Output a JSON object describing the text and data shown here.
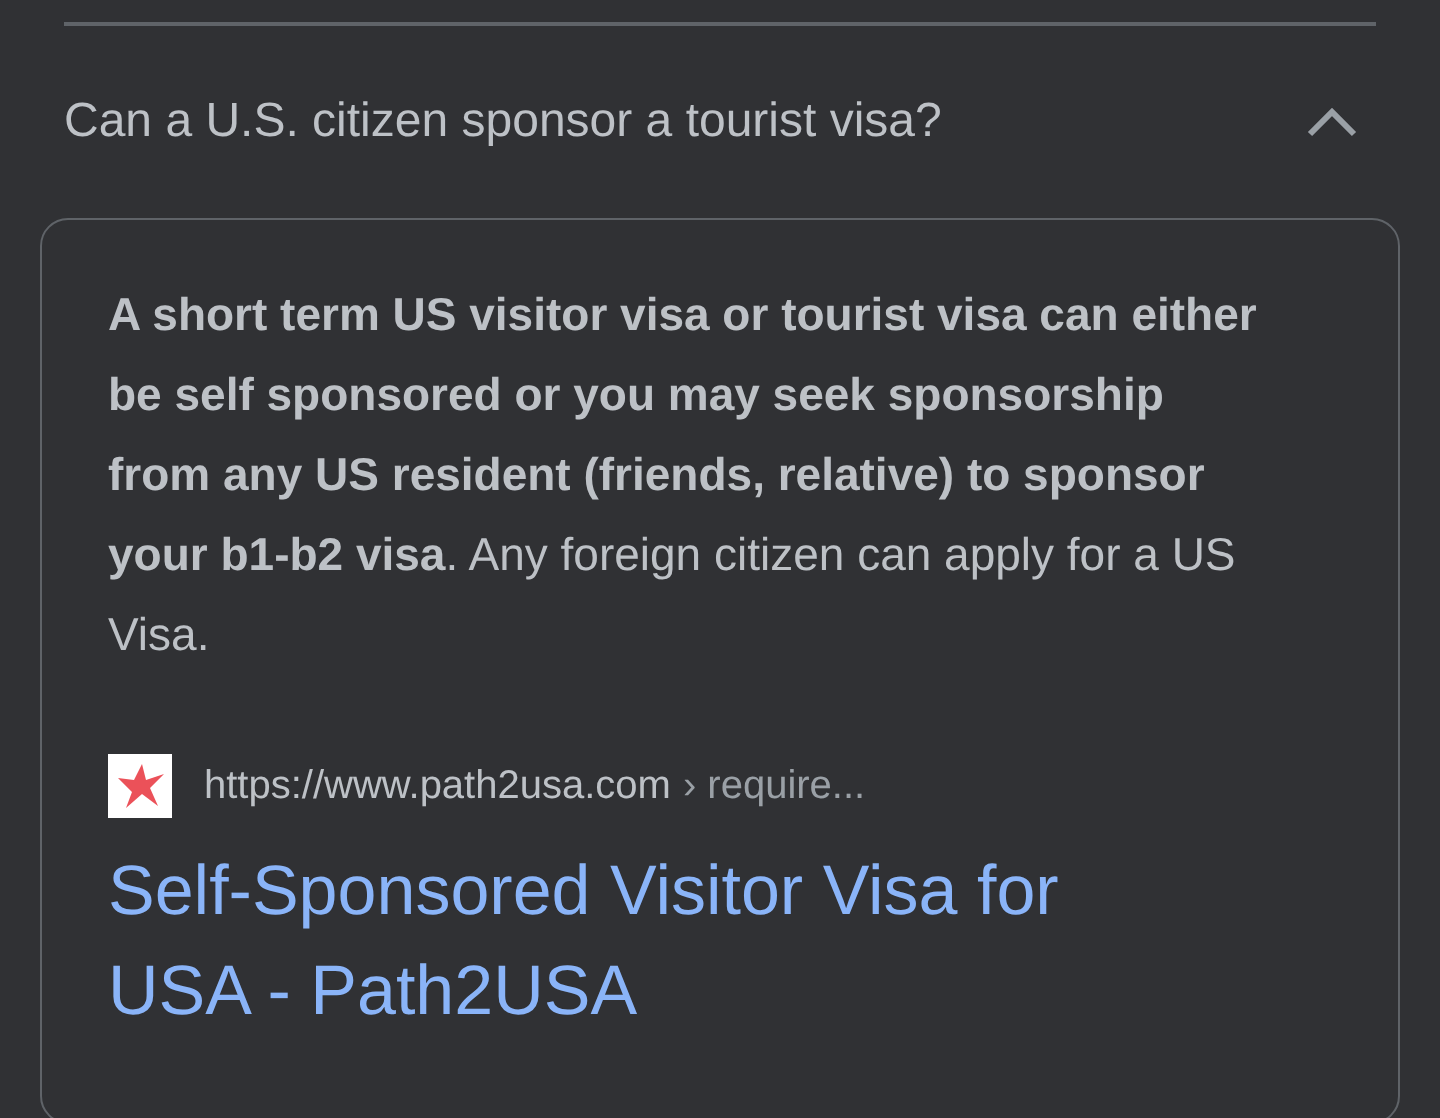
{
  "question": {
    "text": "Can a U.S. citizen sponsor a tourist visa?",
    "expanded": true
  },
  "answer": {
    "snippet": "**A short term US visitor visa or tourist visa can either be self sponsored or you may seek sponsorship from any US resident (friends, relative) to sponsor your b1-b2 visa**. Any foreign citizen can apply for a US Visa.",
    "source": {
      "site": "https://www.path2usa.com",
      "path": "› require..."
    },
    "link": "Self-Sponsored Visitor Visa for USA - Path2USA"
  }
}
